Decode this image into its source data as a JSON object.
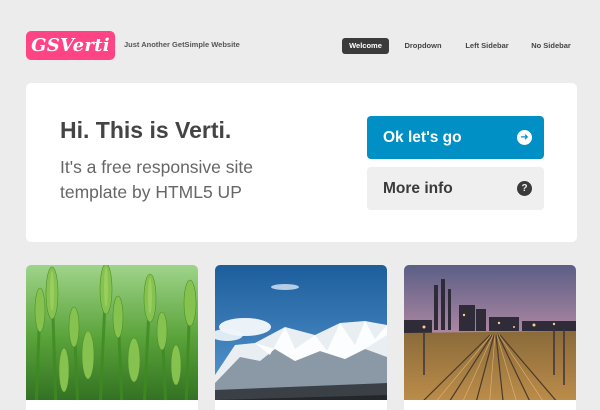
{
  "header": {
    "logo_text": "GSVerti",
    "tagline": "Just Another GetSimple Website",
    "nav": [
      {
        "label": "Welcome",
        "active": true
      },
      {
        "label": "Dropdown",
        "active": false
      },
      {
        "label": "Left Sidebar",
        "active": false
      },
      {
        "label": "No Sidebar",
        "active": false
      }
    ]
  },
  "banner": {
    "title": "Hi. This is Verti.",
    "subtitle": "It's a free responsive site template by HTML5 UP",
    "primary_button": {
      "label": "Ok let's go",
      "icon": "arrow-right-circle-icon"
    },
    "secondary_button": {
      "label": "More info",
      "icon": "question-circle-icon"
    }
  },
  "tiles": [
    {
      "image": "green-wheat-field"
    },
    {
      "image": "snowy-mountains"
    },
    {
      "image": "railway-yard-at-dusk"
    }
  ],
  "colors": {
    "background": "#ececec",
    "logo": "#ff4486",
    "nav_active": "#3b3b3b",
    "primary": "#0090c5",
    "secondary": "#efefef"
  }
}
